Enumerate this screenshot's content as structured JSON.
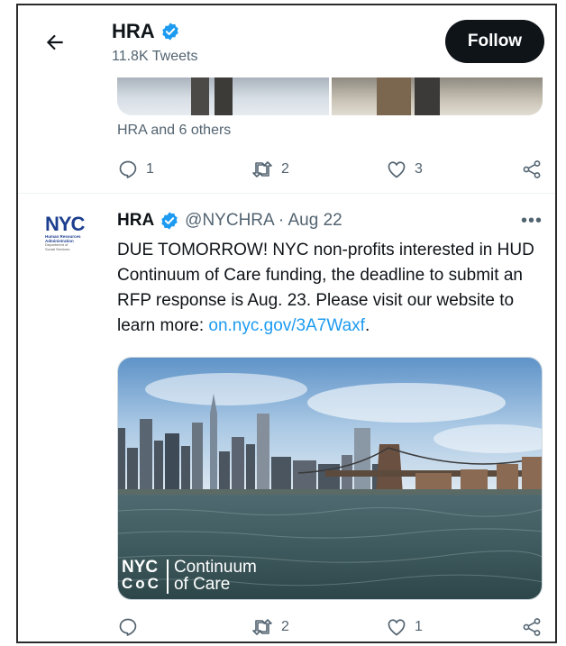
{
  "header": {
    "account_name": "HRA",
    "tweet_count": "11.8K Tweets",
    "follow_label": "Follow"
  },
  "prev_tweet": {
    "liked_by": "HRA and 6 others",
    "replies": "1",
    "retweets": "2",
    "likes": "3"
  },
  "tweet": {
    "avatar_logo": {
      "nyc": "NYC",
      "line1": "Human Resources",
      "line2": "Administration",
      "line3": "Department of",
      "line4": "Social Services"
    },
    "name": "HRA",
    "handle_date": "@NYCHRA · Aug 22",
    "more": "•••",
    "body_text": "DUE TOMORROW! NYC non-profits interested in HUD Continuum of Care funding, the deadline to submit an RFP response is Aug. 23.  Please visit our website to learn more: ",
    "link_text": "on.nyc.gov/3A7Waxf",
    "after_link": ".",
    "media_badge": {
      "nyc": "NYC",
      "coc": "CoC",
      "title_line1": "Continuum",
      "title_line2": "of Care"
    },
    "replies": "",
    "retweets": "2",
    "likes": "1"
  },
  "colors": {
    "link": "#1d9bf0",
    "verified": "#1d9bf0",
    "follow_bg": "#0f1419",
    "muted": "#536471"
  }
}
